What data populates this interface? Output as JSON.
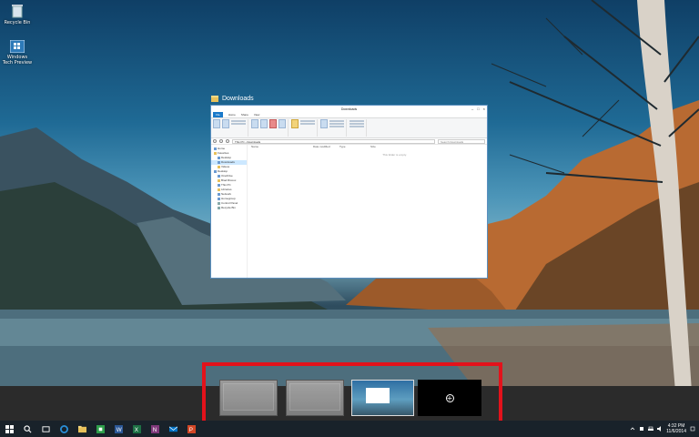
{
  "desktop": {
    "icons": [
      {
        "label": "Recycle Bin",
        "name": "recycle-bin-icon"
      },
      {
        "label": "Windows Tech Preview",
        "name": "windows-tech-preview-icon"
      }
    ]
  },
  "explorer": {
    "window_caption": "Downloads",
    "title": "Downloads",
    "tabs": [
      "File",
      "Home",
      "Share",
      "View"
    ],
    "ribbon_groups": [
      "Clipboard",
      "Organize",
      "New",
      "Open",
      "Select"
    ],
    "ribbon_labels": [
      "Copy path",
      "Paste shortcut",
      "Move to",
      "Copy to",
      "Delete",
      "Rename",
      "New folder",
      "New item",
      "Easy access",
      "Properties",
      "Open",
      "Edit",
      "History",
      "Select all",
      "Select none",
      "Invert selection"
    ],
    "address_path": "This PC › Downloads",
    "search_placeholder": "Search Downloads",
    "nav_items": [
      {
        "label": "Home",
        "indent": false
      },
      {
        "label": "Favorites",
        "indent": false
      },
      {
        "label": "Desktop",
        "indent": true
      },
      {
        "label": "Downloads",
        "indent": true,
        "selected": true
      },
      {
        "label": "Videos",
        "indent": true
      },
      {
        "label": "Desktop",
        "indent": false
      },
      {
        "label": "OneDrive",
        "indent": true
      },
      {
        "label": "Brad Ricoux",
        "indent": true
      },
      {
        "label": "This PC",
        "indent": true
      },
      {
        "label": "Libraries",
        "indent": true
      },
      {
        "label": "Network",
        "indent": true
      },
      {
        "label": "Homegroup",
        "indent": true
      },
      {
        "label": "Control Panel",
        "indent": true
      },
      {
        "label": "Recycle Bin",
        "indent": true
      }
    ],
    "columns": [
      "Name",
      "Date modified",
      "Type",
      "Size"
    ],
    "empty_message": "This folder is empty."
  },
  "task_view": {
    "desktops": [
      {
        "name": "desktop-1-thumbnail"
      },
      {
        "name": "desktop-2-thumbnail"
      },
      {
        "name": "desktop-3-thumbnail"
      }
    ],
    "add_symbol": "+"
  },
  "taskbar": {
    "apps": [
      {
        "name": "search-icon",
        "color": "#ffffff"
      },
      {
        "name": "task-view-icon",
        "color": "#ffffff"
      },
      {
        "name": "internet-explorer-icon",
        "color": "#2a8fd8"
      },
      {
        "name": "file-explorer-icon",
        "color": "#e8c15a"
      },
      {
        "name": "store-icon",
        "color": "#2e9e4a"
      },
      {
        "name": "word-icon",
        "color": "#2b5797"
      },
      {
        "name": "excel-icon",
        "color": "#1e7145"
      },
      {
        "name": "onenote-icon",
        "color": "#80397b"
      },
      {
        "name": "outlook-icon",
        "color": "#0072c6"
      },
      {
        "name": "powerpoint-icon",
        "color": "#d24726"
      }
    ],
    "clock_time": "4:32 PM",
    "clock_date": "11/6/2014"
  },
  "colors": {
    "highlight_border": "#e3121b",
    "taskbar_bg": "#19222a",
    "strip_bg": "#2b2b2b",
    "accent": "#1979ca"
  }
}
